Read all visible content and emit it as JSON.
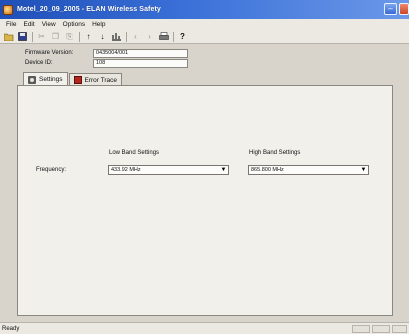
{
  "window": {
    "title": "Motel_20_09_2005 - ELAN Wireless Safety"
  },
  "menu": {
    "items": [
      "File",
      "Edit",
      "View",
      "Options",
      "Help"
    ]
  },
  "toolbar": {
    "buttons": [
      "open-icon",
      "save-icon",
      "cut-icon",
      "copy-icon",
      "paste-icon",
      "arrow-up-icon",
      "arrow-down-icon",
      "chart-icon",
      "previous-icon",
      "next-icon",
      "print-icon",
      "help-icon"
    ]
  },
  "device": {
    "firmware_label": "Firmware Version:",
    "firmware_value": "0435004/001",
    "device_id_label": "Device ID:",
    "device_id_value": "108"
  },
  "tabs": {
    "settings": "Settings",
    "error_trace": "Error Trace"
  },
  "settings": {
    "low_band_heading": "Low Band Settings",
    "high_band_heading": "High Band Settings",
    "frequency_label": "Frequency:",
    "low_band_value": "433.92 MHz",
    "high_band_value": "865.800 MHz"
  },
  "status": {
    "text": "Ready"
  },
  "colors": {
    "titlebar_start": "#1f4fb8",
    "titlebar_end": "#6b98e8",
    "window_face": "#d8d4cc",
    "error_icon": "#b3261e"
  }
}
